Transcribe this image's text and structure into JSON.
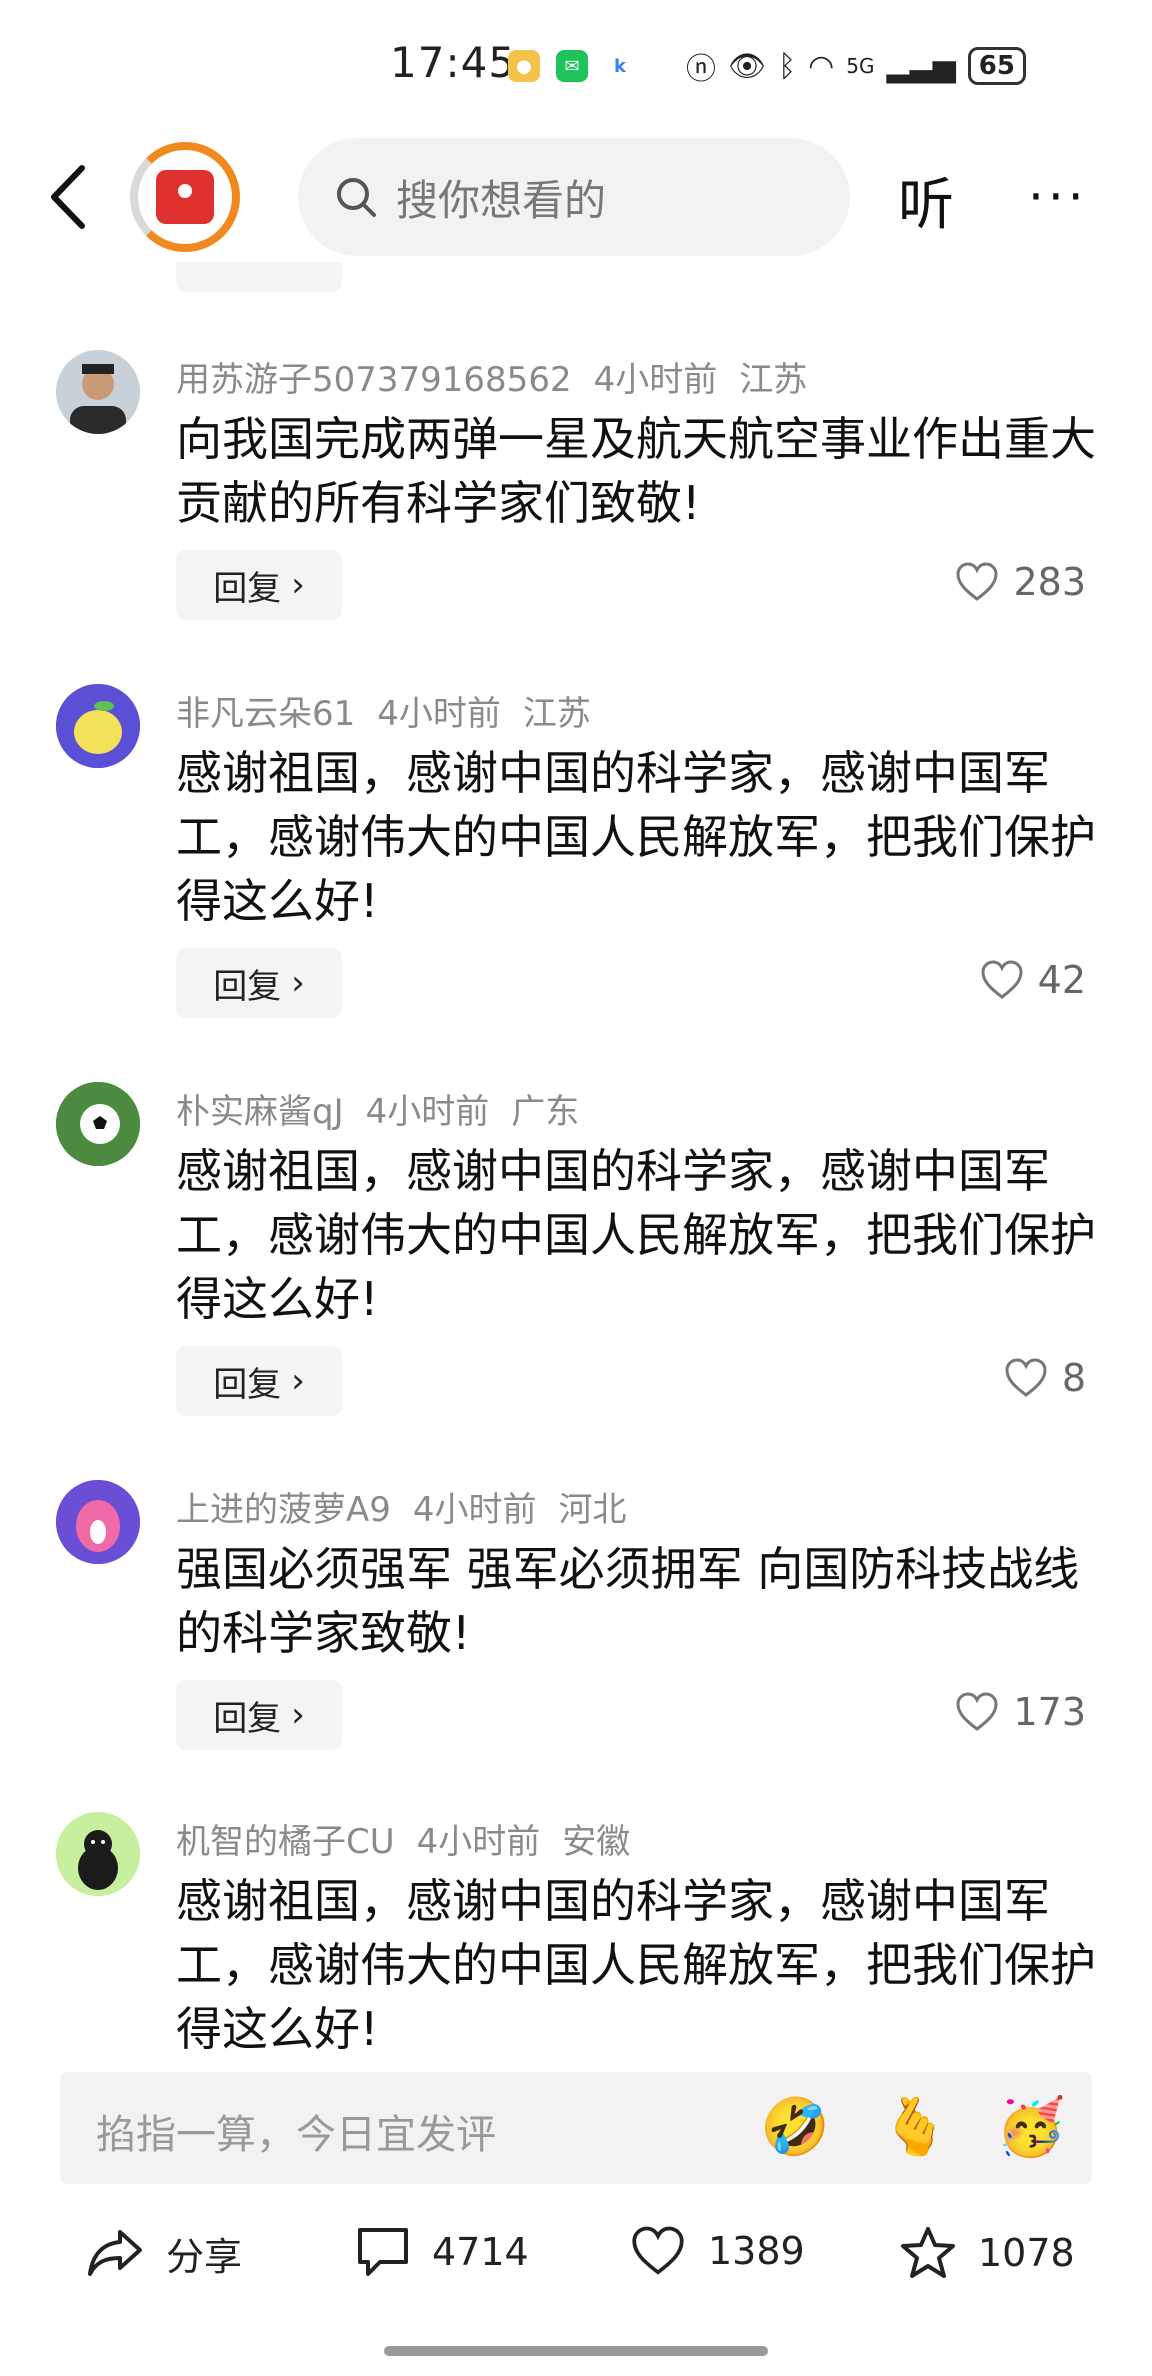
{
  "status_bar": {
    "time": "17:45",
    "signal_label": "5G",
    "battery": "65"
  },
  "top_nav": {
    "search_placeholder": "搜你想看的",
    "listen_label": "听",
    "more_label": "···"
  },
  "comments": [
    {
      "user": "用苏游子507379168562",
      "time": "4小时前",
      "location": "江苏",
      "text": "向我国完成两弹一星及航天航空事业作出重大贡献的所有科学家们致敬!",
      "reply_label": "回复",
      "likes": "283",
      "avatar_color": "#9aa5b1"
    },
    {
      "user": "非凡云朵61",
      "time": "4小时前",
      "location": "江苏",
      "text": "感谢祖国，感谢中国的科学家，感谢中国军工，感谢伟大的中国人民解放军，把我们保护得这么好!",
      "reply_label": "回复",
      "likes": "42",
      "avatar_color": "#5b4fd6"
    },
    {
      "user": "朴实麻酱qJ",
      "time": "4小时前",
      "location": "广东",
      "text": "感谢祖国，感谢中国的科学家，感谢中国军工，感谢伟大的中国人民解放军，把我们保护得这么好!",
      "reply_label": "回复",
      "likes": "8",
      "avatar_color": "#3f7a3c"
    },
    {
      "user": "上进的菠萝A9",
      "time": "4小时前",
      "location": "河北",
      "text": "强国必须强军 强军必须拥军 向国防科技战线的科学家致敬!",
      "reply_label": "回复",
      "likes": "173",
      "avatar_color": "#6a4fd6"
    },
    {
      "user": "机智的橘子CU",
      "time": "4小时前",
      "location": "安徽",
      "text": "感谢祖国，感谢中国的科学家，感谢中国军工，感谢伟大的中国人民解放军，把我们保护得这么好!",
      "avatar_color": "#c6ef9e"
    }
  ],
  "input_bar": {
    "placeholder": "掐指一算，今日宜发评",
    "emojis": [
      "🤣",
      "🫰",
      "🥳"
    ]
  },
  "actions": {
    "share_label": "分享",
    "comments_count": "4714",
    "likes_count": "1389",
    "favorites_count": "1078"
  }
}
